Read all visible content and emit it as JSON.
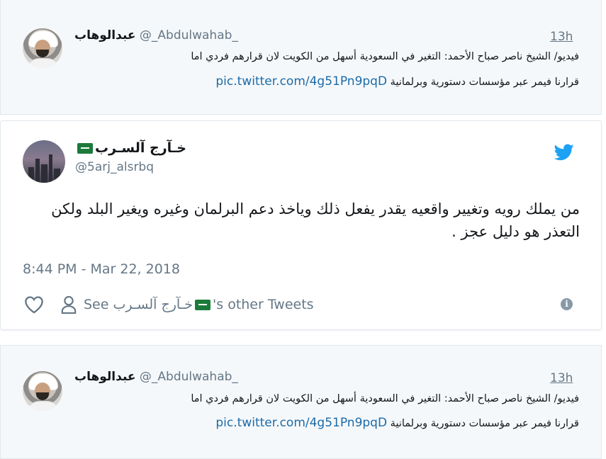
{
  "quoted_tweets": [
    {
      "name": "عبدالوهاب",
      "handle": "@_Abdulwahab_",
      "time": "13h",
      "line1": "فيديو/ الشيخ ناصر صباح الأحمد: التغير في السعودية أسهل من الكويت لان قرارهم فردي اما",
      "line2": "قرارنا فيمر عبر مؤسسات دستورية وبرلمانية",
      "link": "pic.twitter.com/4g51Pn9pqD"
    },
    {
      "name": "عبدالوهاب",
      "handle": "@_Abdulwahab_",
      "time": "13h",
      "line1": "فيديو/ الشيخ ناصر صباح الأحمد: التغير في السعودية أسهل من الكويت لان قرارهم فردي اما",
      "line2": "قرارنا فيمر عبر مؤسسات دستورية وبرلمانية",
      "link": "pic.twitter.com/4g51Pn9pqD"
    }
  ],
  "embedded_tweet": {
    "display_name": "خـآرج آلسـرب",
    "handle": "@5arj_alsrbq",
    "text": "من يملك رويه وتغيير واقعيه  يقدر يفعل ذلك وياخذ دعم البرلمان وغيره ويغير البلد ولكن التعذر هو دليل عجز .",
    "timestamp": "8:44 PM - Mar 22, 2018",
    "see_prefix": "See ",
    "see_name": "خـآرج آلسـرب",
    "see_suffix": "'s other Tweets",
    "info_glyph": "i",
    "colors": {
      "link": "#1b6ba8",
      "twitter_blue": "#1da1f2",
      "muted": "#657786"
    }
  },
  "icons": [
    "twitter-bird-icon",
    "heart-icon",
    "person-icon",
    "info-icon",
    "saudi-flag-icon"
  ]
}
